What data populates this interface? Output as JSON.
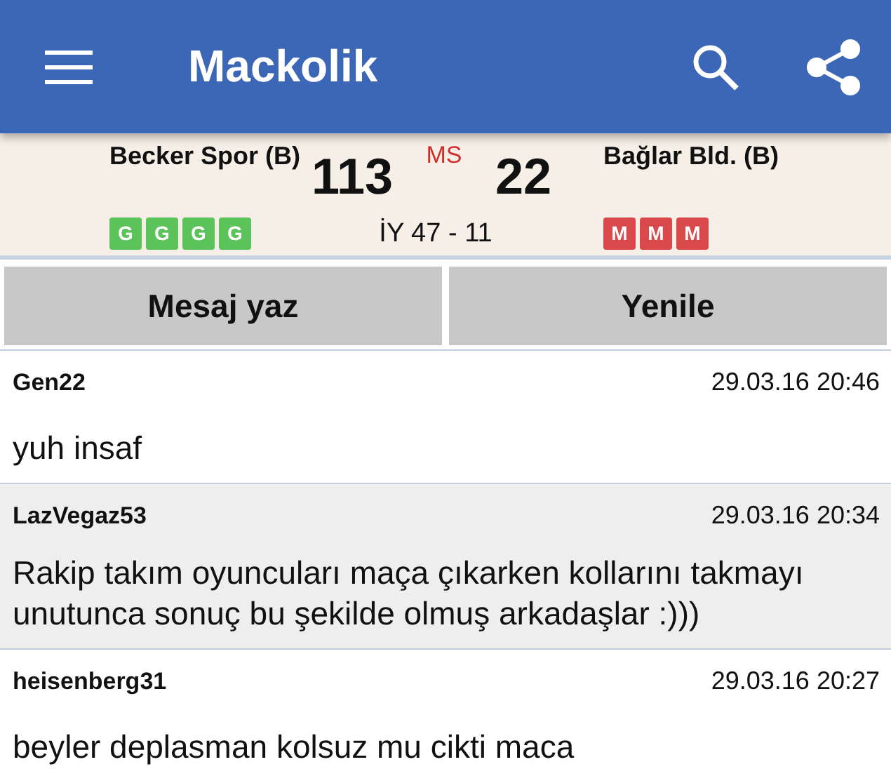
{
  "app_bar": {
    "title": "Mackolik"
  },
  "match": {
    "home_team": "Becker Spor (B)",
    "home_score": "113",
    "status": "MS",
    "away_score": "22",
    "away_team": "Bağlar Bld. (B)",
    "half_time": "İY 47 - 11",
    "home_form": [
      {
        "label": "G",
        "color": "#5cc25a"
      },
      {
        "label": "G",
        "color": "#5cc25a"
      },
      {
        "label": "G",
        "color": "#5cc25a"
      },
      {
        "label": "G",
        "color": "#5cc25a"
      }
    ],
    "away_form": [
      {
        "label": "M",
        "color": "#d9484a"
      },
      {
        "label": "M",
        "color": "#d9484a"
      },
      {
        "label": "M",
        "color": "#d9484a"
      }
    ]
  },
  "buttons": [
    "Mesaj yaz",
    "Yenile"
  ],
  "comments": [
    {
      "user": "Gen22",
      "time": "29.03.16 20:46",
      "text": "yuh insaf",
      "highlighted": false
    },
    {
      "user": "LazVegaz53",
      "time": "29.03.16 20:34",
      "text": "Rakip takım oyuncuları maça çıkarken kollarını takmayı unutunca sonuç bu şekilde olmuş arkadaşlar :)))",
      "highlighted": true
    },
    {
      "user": "heisenberg31",
      "time": "29.03.16 20:27",
      "text": "beyler deplasman kolsuz mu cikti maca",
      "highlighted": false
    }
  ]
}
